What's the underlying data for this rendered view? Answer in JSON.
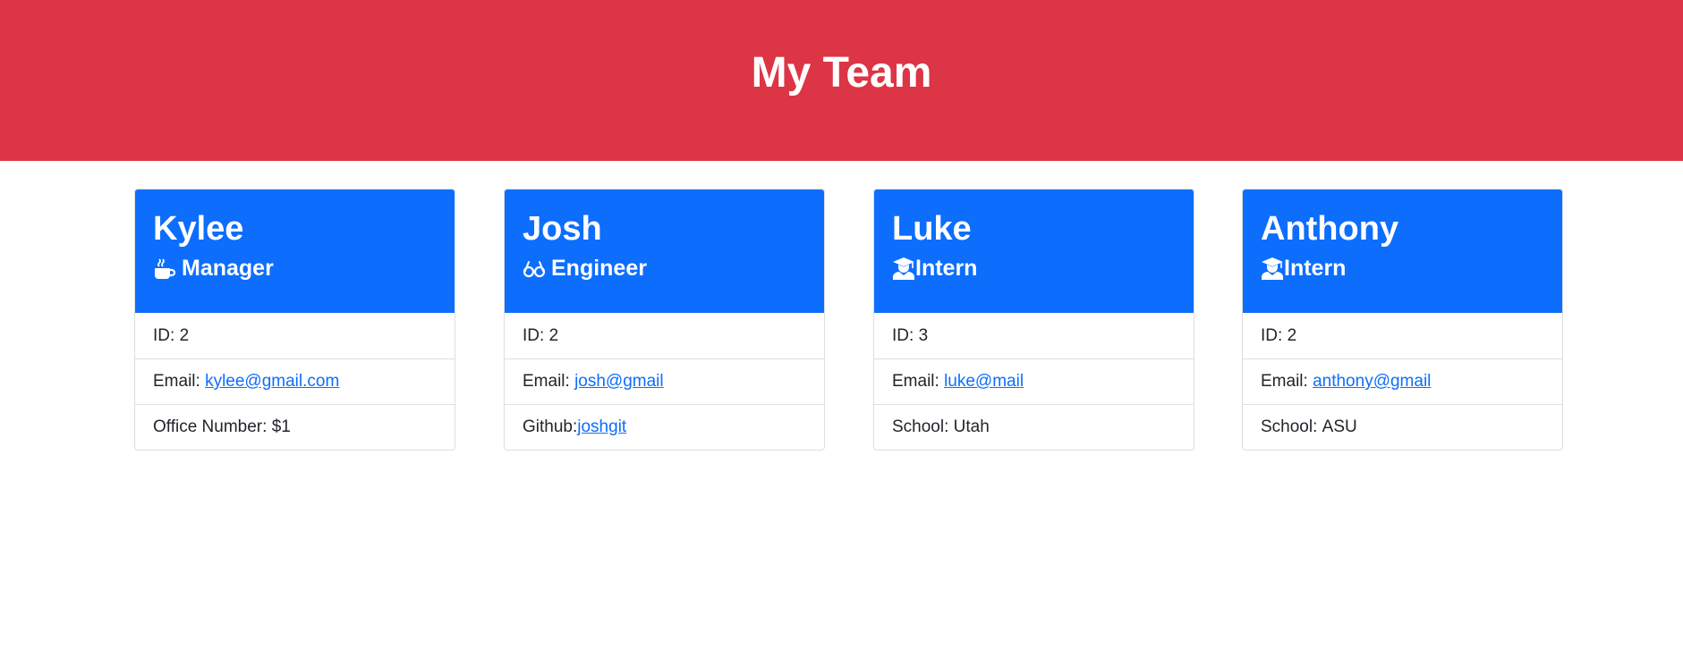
{
  "header": {
    "title": "My Team"
  },
  "colors": {
    "header_bg": "#dc3545",
    "card_header_bg": "#0d6efd",
    "link": "#0d6efd"
  },
  "cards": [
    {
      "name": "Kylee",
      "role": "Manager",
      "icon": "coffee-icon",
      "id_label": "ID: ",
      "id": "2",
      "email_label": "Email: ",
      "email": "kylee@gmail.com",
      "extra_label": "Office Number: ",
      "extra_value": "$1"
    },
    {
      "name": "Josh",
      "role": "Engineer",
      "icon": "glasses-icon",
      "id_label": "ID: ",
      "id": "2",
      "email_label": "Email: ",
      "email": "josh@gmail",
      "extra_label": "Github:",
      "extra_value": "joshgit"
    },
    {
      "name": "Luke",
      "role": "Intern",
      "icon": "graduate-icon",
      "id_label": "ID: ",
      "id": "3",
      "email_label": "Email: ",
      "email": "luke@mail",
      "extra_label": "School: ",
      "extra_value": "Utah"
    },
    {
      "name": "Anthony",
      "role": "Intern",
      "icon": "graduate-icon",
      "id_label": "ID: ",
      "id": "2",
      "email_label": "Email: ",
      "email": "anthony@gmail",
      "extra_label": "School: ",
      "extra_value": "ASU"
    }
  ]
}
